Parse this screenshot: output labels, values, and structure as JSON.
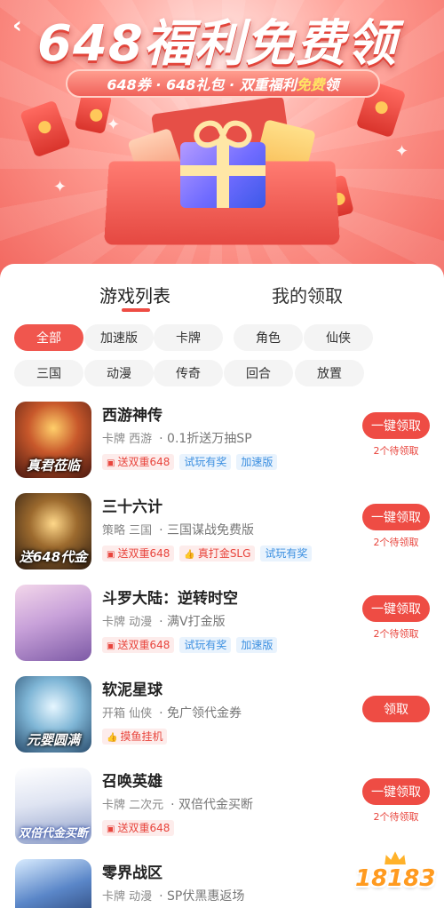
{
  "header": {
    "back_icon": "back-arrow-icon",
    "title": "648福利免费领",
    "subtitle_part1": "648券 · 648礼包 · 双重福利",
    "subtitle_highlight": "免费",
    "subtitle_part2": "领"
  },
  "tabs": [
    {
      "label": "游戏列表",
      "active": true
    },
    {
      "label": "我的领取",
      "active": false
    }
  ],
  "categories": [
    {
      "label": "全部",
      "active": true
    },
    {
      "label": "加速版",
      "active": false
    },
    {
      "label": "卡牌",
      "active": false
    },
    {
      "label": "角色",
      "active": false
    },
    {
      "label": "仙侠",
      "active": false
    },
    {
      "label": "三国",
      "active": false
    },
    {
      "label": "动漫",
      "active": false
    },
    {
      "label": "传奇",
      "active": false
    },
    {
      "label": "回合",
      "active": false
    },
    {
      "label": "放置",
      "active": false
    }
  ],
  "games": [
    {
      "name": "西游神传",
      "tags": "卡牌 西游",
      "desc": "· 0.1折送万抽SP",
      "icon_text": "真君莅临",
      "badges": [
        {
          "text": "送双重648",
          "type": "red",
          "icon": "ticket-icon"
        },
        {
          "text": "试玩有奖",
          "type": "blue"
        },
        {
          "text": "加速版",
          "type": "blue"
        }
      ],
      "button": "一键领取",
      "pending": "2个待领取"
    },
    {
      "name": "三十六计",
      "tags": "策略 三国",
      "desc": "· 三国谋战免费版",
      "icon_text": "送648代金",
      "badges": [
        {
          "text": "送双重648",
          "type": "red",
          "icon": "ticket-icon"
        },
        {
          "text": "真打金SLG",
          "type": "red",
          "icon": "thumb-icon"
        },
        {
          "text": "试玩有奖",
          "type": "blue"
        }
      ],
      "button": "一键领取",
      "pending": "2个待领取"
    },
    {
      "name": "斗罗大陆：逆转时空",
      "tags": "卡牌 动漫",
      "desc": "· 满V打金版",
      "icon_text": "",
      "badges": [
        {
          "text": "送双重648",
          "type": "red",
          "icon": "ticket-icon"
        },
        {
          "text": "试玩有奖",
          "type": "blue"
        },
        {
          "text": "加速版",
          "type": "blue"
        }
      ],
      "button": "一键领取",
      "pending": "2个待领取"
    },
    {
      "name": "软泥星球",
      "tags": "开箱 仙侠",
      "desc": "· 免广领代金券",
      "icon_text": "元婴圆满",
      "badges": [
        {
          "text": "摸鱼挂机",
          "type": "red",
          "icon": "thumb-icon"
        }
      ],
      "button": "领取",
      "pending": ""
    },
    {
      "name": "召唤英雄",
      "tags": "卡牌 二次元",
      "desc": "· 双倍代金买断",
      "icon_text": "双倍代金买断",
      "badges": [
        {
          "text": "送双重648",
          "type": "red",
          "icon": "ticket-icon"
        }
      ],
      "button": "一键领取",
      "pending": "2个待领取"
    },
    {
      "name": "零界战区",
      "tags": "卡牌 动漫",
      "desc": "· SP伏黑惠返场",
      "icon_text": "",
      "badges": [],
      "button": "",
      "pending": ""
    }
  ],
  "watermark": {
    "text": "18183"
  },
  "colors": {
    "accent": "#ee4c44",
    "blue_tag": "#3b8fe0",
    "chip_bg": "#f4f4f4"
  }
}
